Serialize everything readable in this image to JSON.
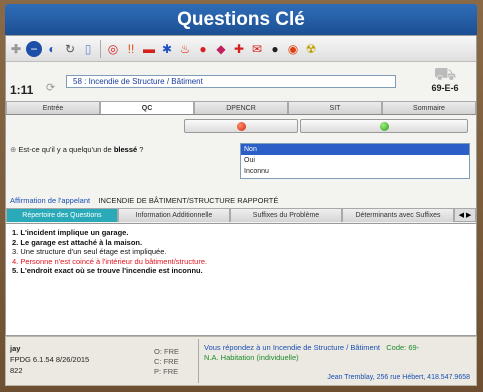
{
  "title": "Questions Clé",
  "timer": "1:11",
  "case_name": "58 : Incendie de Structure / Bâtiment",
  "determinant_code": "69-E-6",
  "tabs": [
    "Entrée",
    "QC",
    "DPENCR",
    "SIT",
    "Sommaire"
  ],
  "active_tab": 1,
  "question": {
    "prefix": "Est-ce qu'il y a quelqu'un de ",
    "emphasis": "blessé",
    "suffix": " ?"
  },
  "answers": [
    "Non",
    "Oui",
    "Inconnu"
  ],
  "selected_answer": 0,
  "affirmation": {
    "label": "Affirmation de l'appelant",
    "value": "INCENDIE DE BÂTIMENT/STRUCTURE RAPPORTÉ"
  },
  "subtabs": [
    "Répertoire des Questions",
    "Information Additionnelle",
    "Suffixes du Problème",
    "Déterminants avec Suffixes"
  ],
  "subtab_arrows": "◀ ▶",
  "findings": [
    {
      "num": "1.",
      "text": "L'incident implique un garage.",
      "style": "bold"
    },
    {
      "num": "2.",
      "text": "Le garage est attaché à la maison.",
      "style": "bold"
    },
    {
      "num": "3.",
      "text": "Une structure d'un seul étage est impliquée.",
      "style": "normal"
    },
    {
      "num": "4.",
      "text": "Personne n'est coincé à l'intérieur du bâtiment/structure.",
      "style": "red"
    },
    {
      "num": "5.",
      "text": "L'endroit exact où se trouve l'incendie est inconnu.",
      "style": "bold"
    }
  ],
  "status": {
    "user": "jay",
    "version": "FPDG 6.1.54 8/26/2015",
    "number": "822",
    "freq_lines": [
      "O: FRE",
      "C: FRE",
      "P: FRE"
    ],
    "message_prefix": "Vous répondez à un ",
    "message_case": "Incendie de Structure / Bâtiment",
    "message_code_label": "Code: 69-",
    "message_line2": "N.A. Habitation (individuelle)",
    "footer": "Jean Tremblay, 256 rue Hébert, 418.547.9658"
  },
  "colors": {
    "title_bg": "#2565b0",
    "active_subtab": "#2aa9b8",
    "red_text": "#e0141e",
    "selected_answer": "#2b5fc7"
  }
}
